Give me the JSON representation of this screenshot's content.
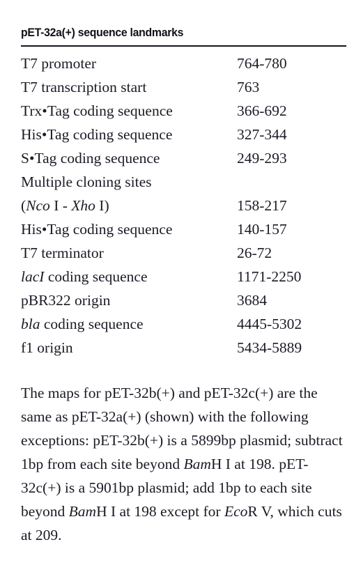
{
  "title": "pET-32a(+) sequence landmarks",
  "table": {
    "rows": [
      {
        "name": "T7 promoter",
        "position": "764-780"
      },
      {
        "name": "T7 transcription start",
        "position": "763"
      },
      {
        "name": "Trx•Tag coding sequence",
        "position": "366-692"
      },
      {
        "name": "His•Tag coding sequence",
        "position": "327-344"
      },
      {
        "name": "S•Tag coding sequence",
        "position": "249-293"
      },
      {
        "name": "Multiple cloning sites",
        "position": ""
      },
      {
        "name_prefix": "(",
        "name_italic_1": "Nco",
        "name_mid": " I - ",
        "name_italic_2": "Xho",
        "name_suffix": " I)",
        "position": "158-217"
      },
      {
        "name": "His•Tag coding sequence",
        "position": "140-157"
      },
      {
        "name": "T7 terminator",
        "position": "26-72"
      },
      {
        "name_italic_1": "lacI",
        "name_suffix": " coding sequence",
        "position": "1171-2250"
      },
      {
        "name": "pBR322 origin",
        "position": "3684"
      },
      {
        "name_italic_1": "bla",
        "name_suffix": " coding sequence",
        "position": "4445-5302"
      },
      {
        "name": "f1 origin",
        "position": "5434-5889"
      }
    ]
  },
  "note": {
    "seg1": "The maps for pET-32b(+) and pET-32c(+) are the same as pET-32a(+) (shown) with the following exceptions: pET-32b(+) is a 5899bp plasmid; subtract 1bp from each site beyond ",
    "enzyme1": "Bam",
    "seg2": "H I at 198. pET-32c(+) is a 5901bp plasmid; add 1bp to each site beyond ",
    "enzyme2": "Bam",
    "seg3": "H I at 198 except for ",
    "enzyme3": "Eco",
    "seg4": "R V, which cuts at 209."
  }
}
